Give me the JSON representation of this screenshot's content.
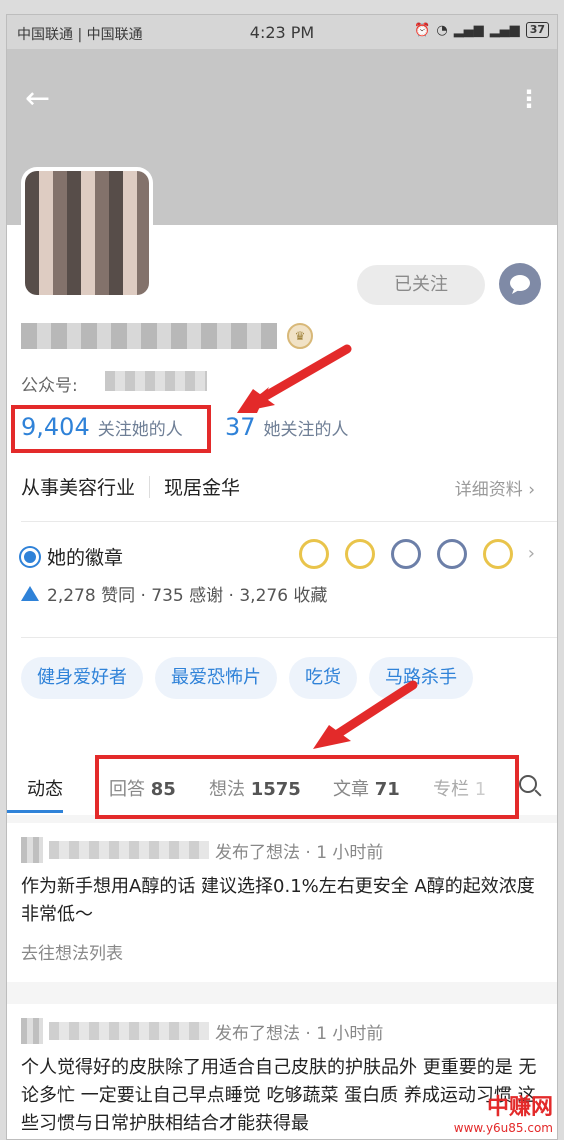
{
  "status_bar": {
    "carriers": "中国联通 | 中国联通",
    "time": "4:23 PM",
    "battery": "37"
  },
  "profile": {
    "follow_button": "已关注",
    "public_account_label": "公众号:",
    "followers_count": "9,404",
    "followers_label": "关注她的人",
    "following_count": "37",
    "following_label": "她关注的人",
    "industry": "从事美容行业",
    "location": "现居金华",
    "detail_link": "详细资料",
    "badges_title": "她的徽章",
    "stats": "2,278 赞同 · 735 感谢 · 3,276 收藏"
  },
  "tags": [
    "健身爱好者",
    "最爱恐怖片",
    "吃货",
    "马路杀手"
  ],
  "tabs": {
    "activity": "动态",
    "answers_label": "回答",
    "answers_count": "85",
    "ideas_label": "想法",
    "ideas_count": "1575",
    "articles_label": "文章",
    "articles_count": "71",
    "columns_label": "专栏",
    "columns_count": "1"
  },
  "feed": [
    {
      "action": "发布了想法 · 1 小时前",
      "body": "作为新手想用A醇的话 建议选择0.1%左右更安全 A醇的起效浓度非常低～",
      "link": "去往想法列表"
    },
    {
      "action": "发布了想法 · 1 小时前",
      "body": "个人觉得好的皮肤除了用适合自己皮肤的护肤品外 更重要的是 无论多忙 一定要让自己早点睡觉 吃够蔬菜 蛋白质 养成运动习惯 这些习惯与日常护肤相结合才能获得最",
      "link": ""
    }
  ],
  "watermark": {
    "name": "中赚网",
    "url": "www.y6u85.com"
  },
  "colors": {
    "accent": "#2f82d8",
    "highlight_red": "#e32a2a"
  }
}
